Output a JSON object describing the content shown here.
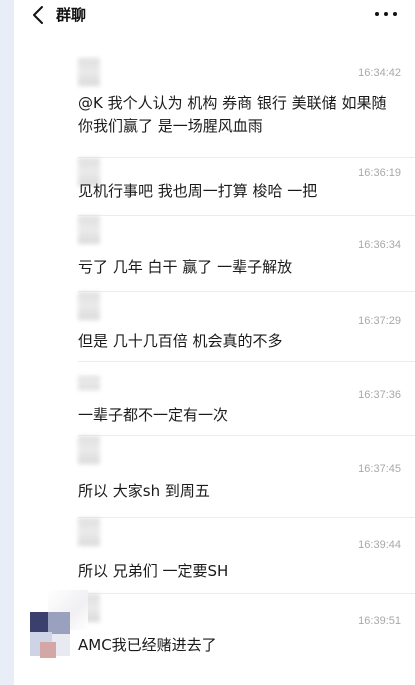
{
  "header": {
    "title": "群聊"
  },
  "messages": [
    {
      "time": "16:34:42",
      "text": "@K 我个人认为 机构 券商 银行 美联储 如果随你我们赢了 是一场腥风血雨"
    },
    {
      "time": "16:36:19",
      "text": "见机行事吧 我也周一打算 梭哈 一把"
    },
    {
      "time": "16:36:34",
      "text": "亏了 几年 白干 赢了 一辈子解放"
    },
    {
      "time": "16:37:29",
      "text": "但是 几十几百倍 机会真的不多"
    },
    {
      "time": "16:37:36",
      "text": "一辈子都不一定有一次"
    },
    {
      "time": "16:37:45",
      "text": "所以 大家sh 到周五"
    },
    {
      "time": "16:39:44",
      "text": "所以 兄弟们 一定要SH"
    },
    {
      "time": "16:39:51",
      "text": "AMC我已经赌进去了"
    }
  ]
}
